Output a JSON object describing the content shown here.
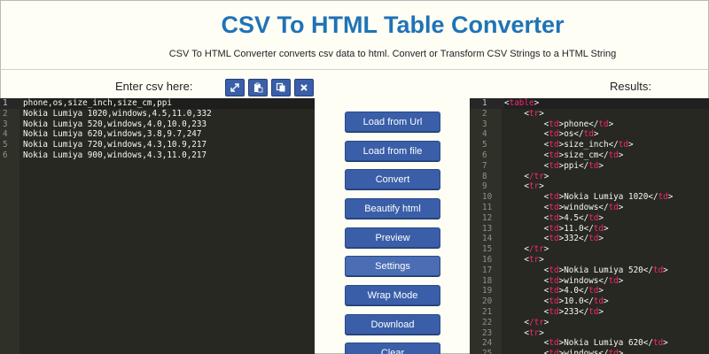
{
  "header": {
    "title": "CSV To HTML Table Converter",
    "subtitle": "CSV To HTML Converter converts csv data to html. Convert or Transform CSV Strings to a HTML String"
  },
  "input_panel": {
    "label": "Enter csv here:",
    "toolbar_icons": [
      "expand-icon",
      "paste-icon",
      "copy-icon",
      "close-icon"
    ],
    "line_numbers": [
      "1",
      "2",
      "3",
      "4",
      "5",
      "6"
    ],
    "lines": [
      "phone,os,size_inch,size_cm,ppi",
      "Nokia Lumiya 1020,windows,4.5,11.0,332",
      "Nokia Lumiya 520,windows,4.0,10.0,233",
      "Nokia Lumiya 620,windows,3.8,9.7,247",
      "Nokia Lumiya 720,windows,4.3,10.9,217",
      "Nokia Lumiya 900,windows,4.3,11.0,217"
    ]
  },
  "actions": {
    "load_url": "Load from Url",
    "load_file": "Load from file",
    "convert": "Convert",
    "beautify": "Beautify html",
    "preview": "Preview",
    "settings": "Settings",
    "wrap_mode": "Wrap Mode",
    "download": "Download",
    "clear": "Clear"
  },
  "output_panel": {
    "label": "Results:",
    "line_numbers": [
      "1",
      "2",
      "3",
      "4",
      "5",
      "6",
      "7",
      "8",
      "9",
      "10",
      "11",
      "12",
      "13",
      "14",
      "15",
      "16",
      "17",
      "18",
      "19",
      "20",
      "21",
      "22",
      "23",
      "24",
      "25"
    ],
    "lines": [
      {
        "indent": "",
        "tag": "table",
        "close": false,
        "text": ""
      },
      {
        "indent": "    ",
        "tag": "tr",
        "close": false,
        "text": ""
      },
      {
        "indent": "        ",
        "tag": "td",
        "close": true,
        "text": "phone"
      },
      {
        "indent": "        ",
        "tag": "td",
        "close": true,
        "text": "os"
      },
      {
        "indent": "        ",
        "tag": "td",
        "close": true,
        "text": "size_inch"
      },
      {
        "indent": "        ",
        "tag": "td",
        "close": true,
        "text": "size_cm"
      },
      {
        "indent": "        ",
        "tag": "td",
        "close": true,
        "text": "ppi"
      },
      {
        "indent": "    ",
        "tag": "/tr",
        "close": false,
        "text": ""
      },
      {
        "indent": "    ",
        "tag": "tr",
        "close": false,
        "text": ""
      },
      {
        "indent": "        ",
        "tag": "td",
        "close": true,
        "text": "Nokia Lumiya 1020"
      },
      {
        "indent": "        ",
        "tag": "td",
        "close": true,
        "text": "windows"
      },
      {
        "indent": "        ",
        "tag": "td",
        "close": true,
        "text": "4.5"
      },
      {
        "indent": "        ",
        "tag": "td",
        "close": true,
        "text": "11.0"
      },
      {
        "indent": "        ",
        "tag": "td",
        "close": true,
        "text": "332"
      },
      {
        "indent": "    ",
        "tag": "/tr",
        "close": false,
        "text": ""
      },
      {
        "indent": "    ",
        "tag": "tr",
        "close": false,
        "text": ""
      },
      {
        "indent": "        ",
        "tag": "td",
        "close": true,
        "text": "Nokia Lumiya 520"
      },
      {
        "indent": "        ",
        "tag": "td",
        "close": true,
        "text": "windows"
      },
      {
        "indent": "        ",
        "tag": "td",
        "close": true,
        "text": "4.0"
      },
      {
        "indent": "        ",
        "tag": "td",
        "close": true,
        "text": "10.0"
      },
      {
        "indent": "        ",
        "tag": "td",
        "close": true,
        "text": "233"
      },
      {
        "indent": "    ",
        "tag": "/tr",
        "close": false,
        "text": ""
      },
      {
        "indent": "    ",
        "tag": "tr",
        "close": false,
        "text": ""
      },
      {
        "indent": "        ",
        "tag": "td",
        "close": true,
        "text": "Nokia Lumiya 620"
      },
      {
        "indent": "        ",
        "tag": "td",
        "close": true,
        "text": "windows"
      }
    ]
  },
  "colors": {
    "accent": "#3a5fa8",
    "title": "#1f73b7",
    "editor_bg": "#272822",
    "tag": "#f92672"
  }
}
